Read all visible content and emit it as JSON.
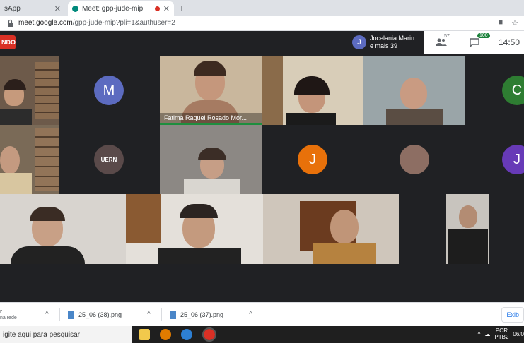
{
  "browser": {
    "tabs": [
      {
        "label": "sApp",
        "close": "✕"
      },
      {
        "label": "Meet: gpp-jude-mip",
        "close": "✕"
      }
    ],
    "new_tab": "+",
    "url_host": "meet.google.com",
    "url_path": "/gpp-jude-mip?pli=1&authuser=2"
  },
  "meet": {
    "rec_label": "NDO",
    "presenter_initial": "J",
    "presenter_name": "Jocelania Marin...",
    "presenter_more": "e mais 39",
    "participants_count": "57",
    "chat_count": "100",
    "time": "14:50",
    "tiles": [
      {
        "initial": "M",
        "color": "#5c6bc0"
      },
      {
        "name": "Fatima Raquel Rosado Mor..."
      },
      {
        "initial": "C",
        "color": "#2e7d32"
      },
      {
        "initial": "J",
        "color": "#e8710a"
      },
      {
        "initial": "J",
        "color": "#673ab7"
      },
      {
        "label": "UERN"
      }
    ]
  },
  "downloads": {
    "items": [
      {
        "name": "r",
        "sub": "na rede"
      },
      {
        "name": "25_06 (38).png"
      },
      {
        "name": "25_06 (37).png"
      }
    ],
    "exit_label": "Exib"
  },
  "taskbar": {
    "search_placeholder": "igite aqui para pesquisar",
    "lang": "POR",
    "layout": "PTB2",
    "date": "06/0"
  }
}
